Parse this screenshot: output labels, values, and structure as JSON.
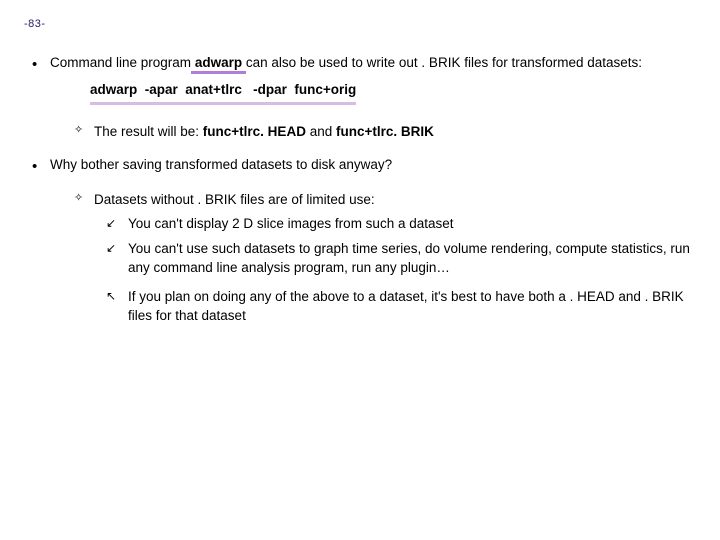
{
  "page_number": "-83-",
  "bullet1": {
    "prefix": "Command line program",
    "kw": " adwarp ",
    "suffix": "can also be used to write out . BRIK files for transformed datasets:",
    "command": "adwarp  -apar  anat+tlrc   -dpar  func+orig",
    "sub": {
      "prefix": "The result will be: ",
      "b1": "func+tlrc. HEAD",
      "mid": " and ",
      "b2": "func+tlrc. BRIK"
    }
  },
  "bullet2": {
    "text": "Why bother saving transformed datasets to disk anyway?",
    "sub1": "Datasets without . BRIK files are of limited use:",
    "s1": "You can't display 2 D slice images from such a dataset",
    "s2": "You can't use such datasets to graph time series, do volume rendering, compute statistics, run any command line analysis program, run any plugin…",
    "s3": "If you plan on doing any of the above to a dataset, it's best to have both a . HEAD and . BRIK files for that dataset"
  }
}
